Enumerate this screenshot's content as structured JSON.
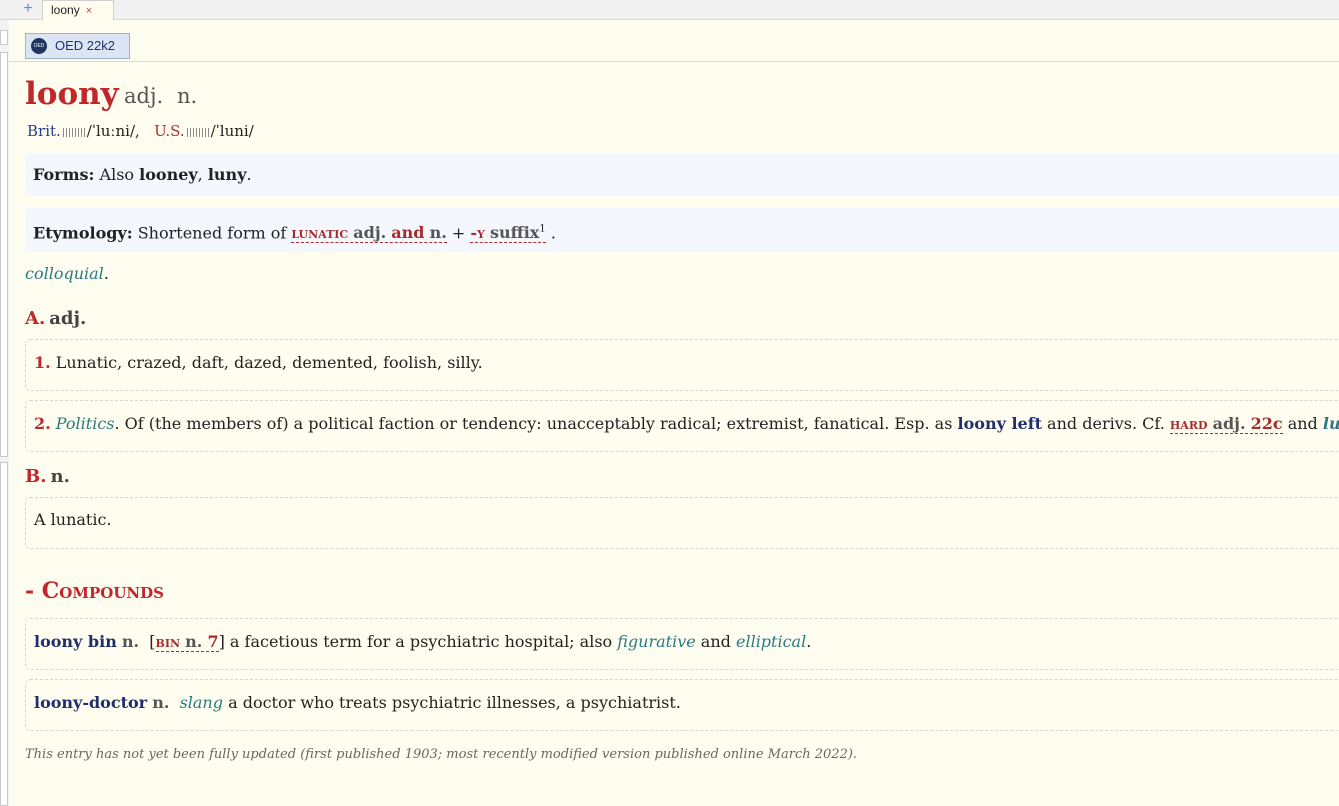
{
  "tabbar": {
    "new_tab_symbol": "+",
    "tab_label": "loony",
    "tab_close": "×"
  },
  "dictionary": {
    "name": "OED 22k2",
    "logo_text": "OED"
  },
  "entry": {
    "headword": "loony",
    "pos": [
      "adj.",
      "n."
    ],
    "pron": {
      "brit_label": "Brit.",
      "brit_ipa": "/ˈluːni/,",
      "us_label": "U.S.",
      "us_ipa": "/ˈluni/"
    },
    "forms": {
      "label": "Forms:",
      "intro": "Also ",
      "form1": "looney",
      "sep": ", ",
      "form2": "luny",
      "end": "."
    },
    "etymology": {
      "label": "Etymology:",
      "text": "Shortened form of ",
      "ref1": "lunatic",
      "ref1_pos1": "adj.",
      "ref1_and": "and",
      "ref1_pos2": "n.",
      "plus": " + ",
      "ref2": "-y",
      "ref2_pos": "suffix",
      "ref2_sup": "1",
      "end": "."
    },
    "register": "colloquial",
    "register_end": ".",
    "section_a": {
      "letter": "A.",
      "pos": "adj."
    },
    "sense1": {
      "num": "1.",
      "text": "Lunatic, crazed, daft, dazed, demented, foolish, silly."
    },
    "sense2": {
      "num": "2.",
      "domain": "Politics",
      "text": ". Of (the members of) a political faction or tendency: unacceptably radical; extremist, fanatical. Esp. as ",
      "phrase": "loony left",
      "text2": " and derivs. Cf. ",
      "ref": "hard",
      "ref_pos": "adj.",
      "ref_sense": "22c",
      "text3": " and ",
      "phrase2": "lunatic fri"
    },
    "section_b": {
      "letter": "B.",
      "pos": "n."
    },
    "sense_b1": {
      "text": "A lunatic."
    },
    "compounds_heading": "- Compounds",
    "compound1": {
      "word": "loony bin",
      "pos": "n.",
      "open": "[",
      "ref": "bin",
      "ref_pos": "n.",
      "ref_num": "7",
      "close": "]",
      "text": " a facetious term for a psychiatric hospital; also ",
      "label1": "figurative",
      "and": " and ",
      "label2": "elliptical",
      "end": "."
    },
    "compound2": {
      "word": "loony-doctor",
      "pos": "n.",
      "label": "slang",
      "text": " a doctor who treats psychiatric illnesses, a psychiatrist."
    },
    "footer": "This entry has not yet been fully updated (first published 1903; most recently modified version published online March 2022)."
  }
}
